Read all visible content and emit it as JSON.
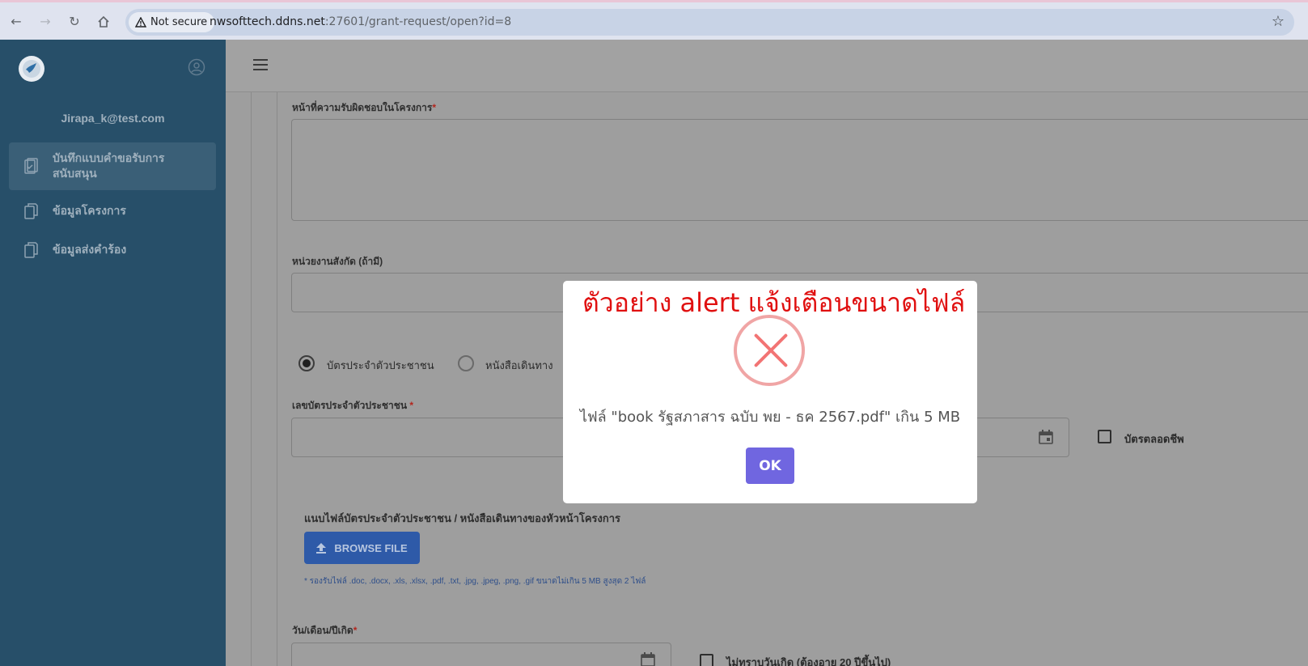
{
  "browser": {
    "security_label": "Not secure",
    "url_host": "nwsofttech.ddns.net",
    "url_rest": ":27601/grant-request/open?id=8"
  },
  "sidebar": {
    "user_email": "Jirapa_k@test.com",
    "items": [
      {
        "label_line1": "บันทึกแบบคำขอรับการ",
        "label_line2": "สนับสนุน",
        "active": true
      },
      {
        "label": "ข้อมูลโครงการ",
        "active": false
      },
      {
        "label": "ข้อมูลส่งคำร้อง",
        "active": false
      }
    ]
  },
  "form": {
    "responsibility_label": "หน้าที่ความรับผิดชอบในโครงการ",
    "affiliation_label": "หน่วยงานสังกัด (ถ้ามี)",
    "id_card_option": "บัตรประจำตัวประชาชน",
    "passport_option": "หนังสือเดินทาง",
    "id_number_label": "เลขบัตรประจำตัวประชาชน",
    "lifetime_card_label": "บัตรตลอดชีพ",
    "attach_label": "แนบไฟล์บัตรประจำตัวประชาชน / หนังสือเดินทางของหัวหน้าโครงการ",
    "browse_button": "BROWSE FILE",
    "file_note": "* รองรับไฟล์ .doc, .docx, .xls, .xlsx, .pdf, .txt, .jpg, .jpeg, .png, .gif ขนาดไม่เกิน 5 MB สูงสุด 2 ไฟล์",
    "birthdate_label": "วัน/เดือน/ปีเกิด",
    "unknown_birthdate_label": "ไม่ทราบวันเกิด (ต้องอายุ 20 ปีขึ้นไป)",
    "required_mark": "*"
  },
  "alert": {
    "caption": "ตัวอย่าง alert แจ้งเตือนขนาดไฟล์",
    "message": "ไฟล์ \"book รัฐสภาสาร ฉบับ พย - ธค 2567.pdf\" เกิน 5 MB",
    "ok_button": "OK"
  },
  "colors": {
    "sidebar_bg": "#274f69",
    "alert_ok": "#7066e0",
    "alert_icon": "#f27474",
    "caption": "#e01010",
    "browse_button": "#2e5aa8"
  }
}
